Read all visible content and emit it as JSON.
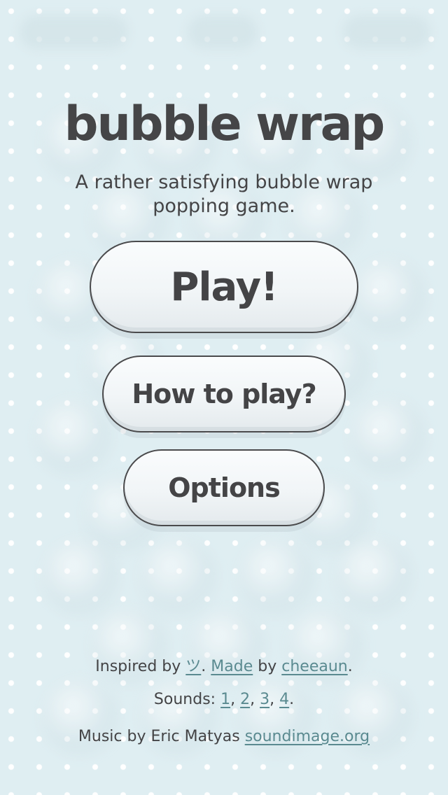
{
  "title": "bubble wrap",
  "tagline_line1": "A rather satisfying bubble wrap",
  "tagline_line2": "popping game.",
  "buttons": {
    "play": "Play!",
    "how_to_play": "How to play?",
    "options": "Options"
  },
  "credits": {
    "inspired_prefix": "Inspired by ",
    "inspired_link": "ツ",
    "inspired_sep": ". ",
    "made_link": "Made",
    "by_text": " by ",
    "author_link": "cheeaun",
    "end_period": ".",
    "sounds_prefix": "Sounds: ",
    "sound_links": [
      "1",
      "2",
      "3",
      "4"
    ],
    "comma": ", ",
    "music_prefix": "Music by Eric Matyas ",
    "music_link": "soundimage.org"
  },
  "colors": {
    "background": "#dfeef2",
    "text": "#444446",
    "link": "#5a8a90",
    "button_border": "#4a4a4c"
  }
}
